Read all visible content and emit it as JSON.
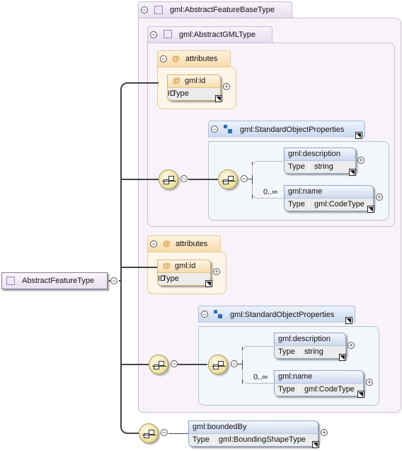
{
  "root": {
    "label": "AbstractFeatureType"
  },
  "outer": {
    "title": "gml:AbstractFeatureBaseType"
  },
  "inner": {
    "title": "gml:AbstractGMLType",
    "attributes": {
      "title": "attributes",
      "attr_name": "gml:id",
      "type_key": "Type",
      "type_value": "ID"
    },
    "group": {
      "title": "gml:StandardObjectProperties",
      "cardinality": "0..∞",
      "elements": [
        {
          "name": "gml:description",
          "type_key": "Type",
          "type_value": "string"
        },
        {
          "name": "gml:name",
          "type_key": "Type",
          "type_value": "gml:CodeType"
        }
      ]
    }
  },
  "outer_attributes": {
    "title": "attributes",
    "attr_name": "gml:id",
    "type_key": "Type",
    "type_value": "ID"
  },
  "outer_group": {
    "title": "gml:StandardObjectProperties",
    "cardinality": "0..∞",
    "elements": [
      {
        "name": "gml:description",
        "type_key": "Type",
        "type_value": "string"
      },
      {
        "name": "gml:name",
        "type_key": "Type",
        "type_value": "gml:CodeType"
      }
    ]
  },
  "bounded": {
    "name": "gml:boundedBy",
    "type_key": "Type",
    "type_value": "gml:BoundingShapeType"
  }
}
